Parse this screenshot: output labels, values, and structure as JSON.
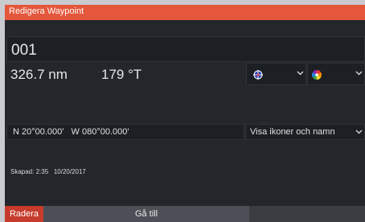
{
  "dialog": {
    "title": "Redigera Waypoint",
    "title_color": "#e4573b"
  },
  "waypoint": {
    "name": "001",
    "distance": "326.7 nm",
    "bearing": "179 °T",
    "icon": "waypoint-target-icon",
    "color": "multicolor-circle-icon",
    "position": "N 20°00.000'   W 080°00.000'",
    "display_mode": "Visa ikoner och namn",
    "created": "Skapad: 2:35   10/20/2017"
  },
  "buttons": {
    "delete": "Radera",
    "delete_color": "#c63b2b",
    "goto": "Gå till"
  }
}
